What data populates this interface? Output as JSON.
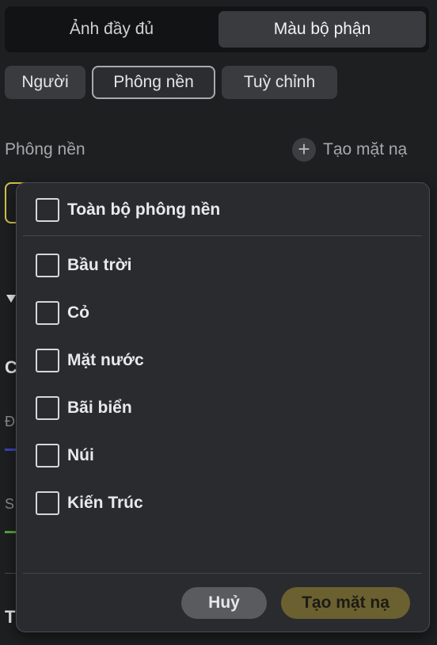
{
  "tabs": [
    {
      "label": "Ảnh đầy đủ",
      "active": false
    },
    {
      "label": "Màu bộ phận",
      "active": true
    }
  ],
  "chips": [
    {
      "label": "Người",
      "selected": false
    },
    {
      "label": "Phông nền",
      "selected": true
    },
    {
      "label": "Tuỳ chỉnh",
      "selected": false
    }
  ],
  "section": {
    "label": "Phông nền",
    "add_mask_label": "Tạo mặt nạ",
    "add_icon": "plus-icon"
  },
  "background_partial": {
    "c_letter": "C",
    "d_letter": "Đ",
    "s_letter": "S",
    "t_letter": "T"
  },
  "dropdown": {
    "all_option": "Toàn bộ phông nền",
    "options": [
      "Bầu trời",
      "Cỏ",
      "Mặt nước",
      "Bãi biển",
      "Núi",
      "Kiến Trúc"
    ],
    "cancel_label": "Huỷ",
    "create_label": "Tạo mặt nạ"
  },
  "colors": {
    "background": "#1e1f21",
    "popup": "#2a2b2e",
    "accent_yellow": "#6b6130"
  }
}
